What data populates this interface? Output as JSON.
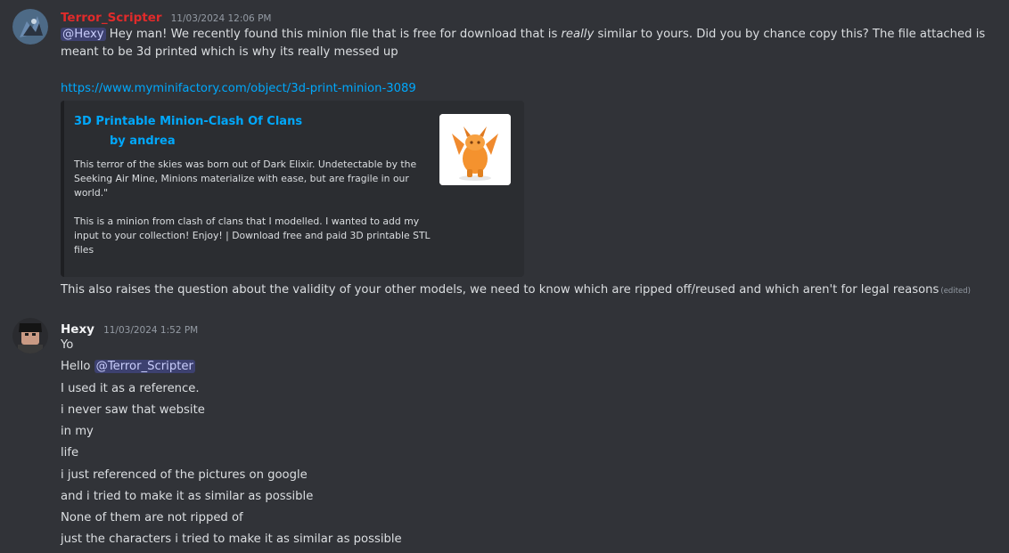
{
  "colors": {
    "background": "#313338",
    "username_terror": "#e02b2b",
    "username_hexy": "#f2f3f5",
    "link": "#00a8fc",
    "mention_bg": "#3c4270"
  },
  "messages": [
    {
      "author": "Terror_Scripter",
      "timestamp": "11/03/2024 12:06 PM",
      "avatar_icon": "dragon-avatar-icon",
      "mention": "@Hexy",
      "body_before_italic": " Hey man! We recently found this minion file that is free for download that is ",
      "body_italic": "really",
      "body_after_italic": " similar to yours. Did you by chance copy this? The file attached is meant to be 3d printed which is why its really messed up",
      "link": "https://www.myminifactory.com/object/3d-print-minion-3089",
      "embed": {
        "title": "3D Printable Minion-Clash Of Clans",
        "author": "by andrea",
        "description_1": "This terror of the skies was born out of Dark Elixir. Undetectable by the Seeking Air Mine, Minions materialize with ease, but are fragile in our world.\"",
        "description_2": "This is a minion from clash of clans that I modelled. I wanted to add my input to your collection! Enjoy! | Download free and paid 3D printable STL files",
        "thumbnail_icon": "minion-model-icon"
      },
      "followup": "This also raises the question about the validity of your other models, we need to know which are ripped off/reused and which aren't for legal reasons",
      "edited_label": "(edited)"
    },
    {
      "author": "Hexy",
      "timestamp": "11/03/2024 1:52 PM",
      "avatar_icon": "roblox-avatar-icon",
      "lines": {
        "l1": "Yo",
        "l2_prefix": "Hello ",
        "l2_mention": "@Terror_Scripter",
        "l3": "I used it as a reference.",
        "l4": "i never saw that website",
        "l5": "in my",
        "l6": "life",
        "l7": "i just referenced of the pictures on google",
        "l8": "and i tried to make it as similar as possible",
        "l9": "None of them are not ripped of",
        "l10": "just the characters i tried to make it as similar as possible"
      }
    }
  ]
}
